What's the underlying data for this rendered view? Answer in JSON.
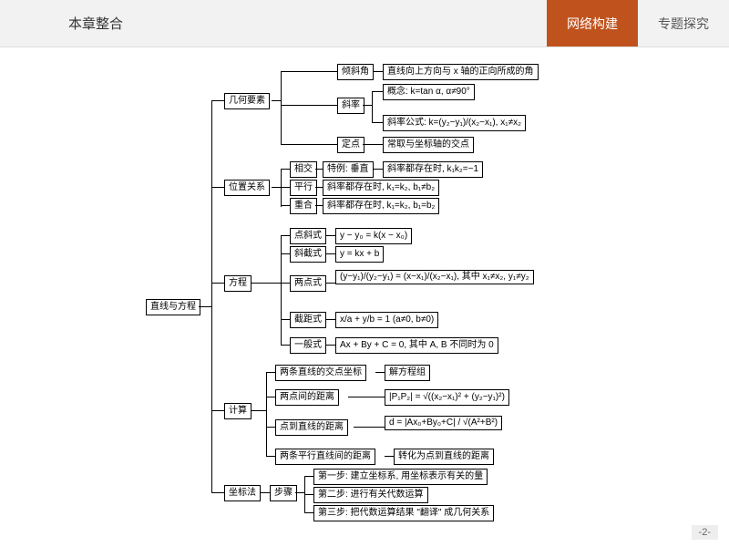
{
  "header": {
    "title": "本章整合",
    "tab1": "网络构建",
    "tab2": "专题探究"
  },
  "page": "-2-",
  "root": "直线与方程",
  "s1": {
    "name": "几何要素",
    "a": "倾斜角",
    "a_def": "直线向上方向与 x 轴的正向所成的角",
    "b": "斜率",
    "b1": "概念: k=tan α, α≠90°",
    "b2": "斜率公式: k=(y₂−y₁)/(x₂−x₁), x₁≠x₂",
    "c": "定点",
    "c1": "常取与坐标轴的交点"
  },
  "s2": {
    "name": "位置关系",
    "a": "相交",
    "a1": "特例: 垂直",
    "a2": "斜率都存在时, k₁k₂=−1",
    "b": "平行",
    "b1": "斜率都存在时, k₁=k₂, b₁≠b₂",
    "c": "重合",
    "c1": "斜率都存在时, k₁=k₂, b₁=b₂"
  },
  "s3": {
    "name": "方程",
    "a": "点斜式",
    "a1": "y − y₀ = k(x − x₀)",
    "b": "斜截式",
    "b1": "y = kx + b",
    "c": "两点式",
    "c1": "(y−y₁)/(y₂−y₁) = (x−x₁)/(x₂−x₁), 其中 x₁≠x₂, y₁≠y₂",
    "d": "截距式",
    "d1": "x/a + y/b = 1 (a≠0, b≠0)",
    "e": "一般式",
    "e1": "Ax + By + C = 0, 其中 A, B 不同时为 0"
  },
  "s4": {
    "name": "计算",
    "a": "两条直线的交点坐标",
    "a1": "解方程组",
    "b": "两点间的距离",
    "b1": "|P₁P₂| = √((x₂−x₁)² + (y₂−y₁)²)",
    "c": "点到直线的距离",
    "c1": "d = |Ax₀+By₀+C| / √(A²+B²)",
    "d": "两条平行直线间的距离",
    "d1": "转化为点到直线的距离"
  },
  "s5": {
    "name": "坐标法",
    "a": "步骤",
    "a1": "第一步: 建立坐标系, 用坐标表示有关的量",
    "a2": "第二步: 进行有关代数运算",
    "a3": "第三步: 把代数运算结果 \"翻译\" 成几何关系"
  }
}
